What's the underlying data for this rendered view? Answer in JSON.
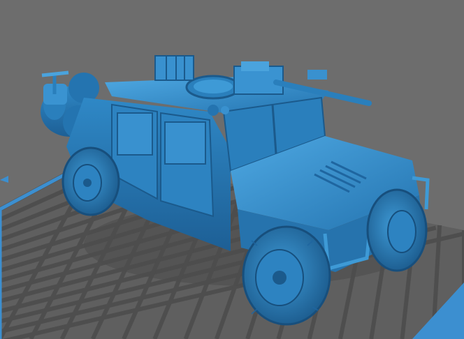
{
  "viewport": {
    "background": "#6d6d6d",
    "model_color": "#2f86c4",
    "model_shadow": "#1c5f92",
    "model_highlight": "#4aa3dd",
    "bed_fill": "#5f5f5f",
    "bed_grid_line": "#4e4e4e",
    "bed_border": "#3c8fd0",
    "bed_corner_marker": "#3c8fd0",
    "model": "armored-vehicle-model",
    "bed": "build-plate-grid"
  }
}
